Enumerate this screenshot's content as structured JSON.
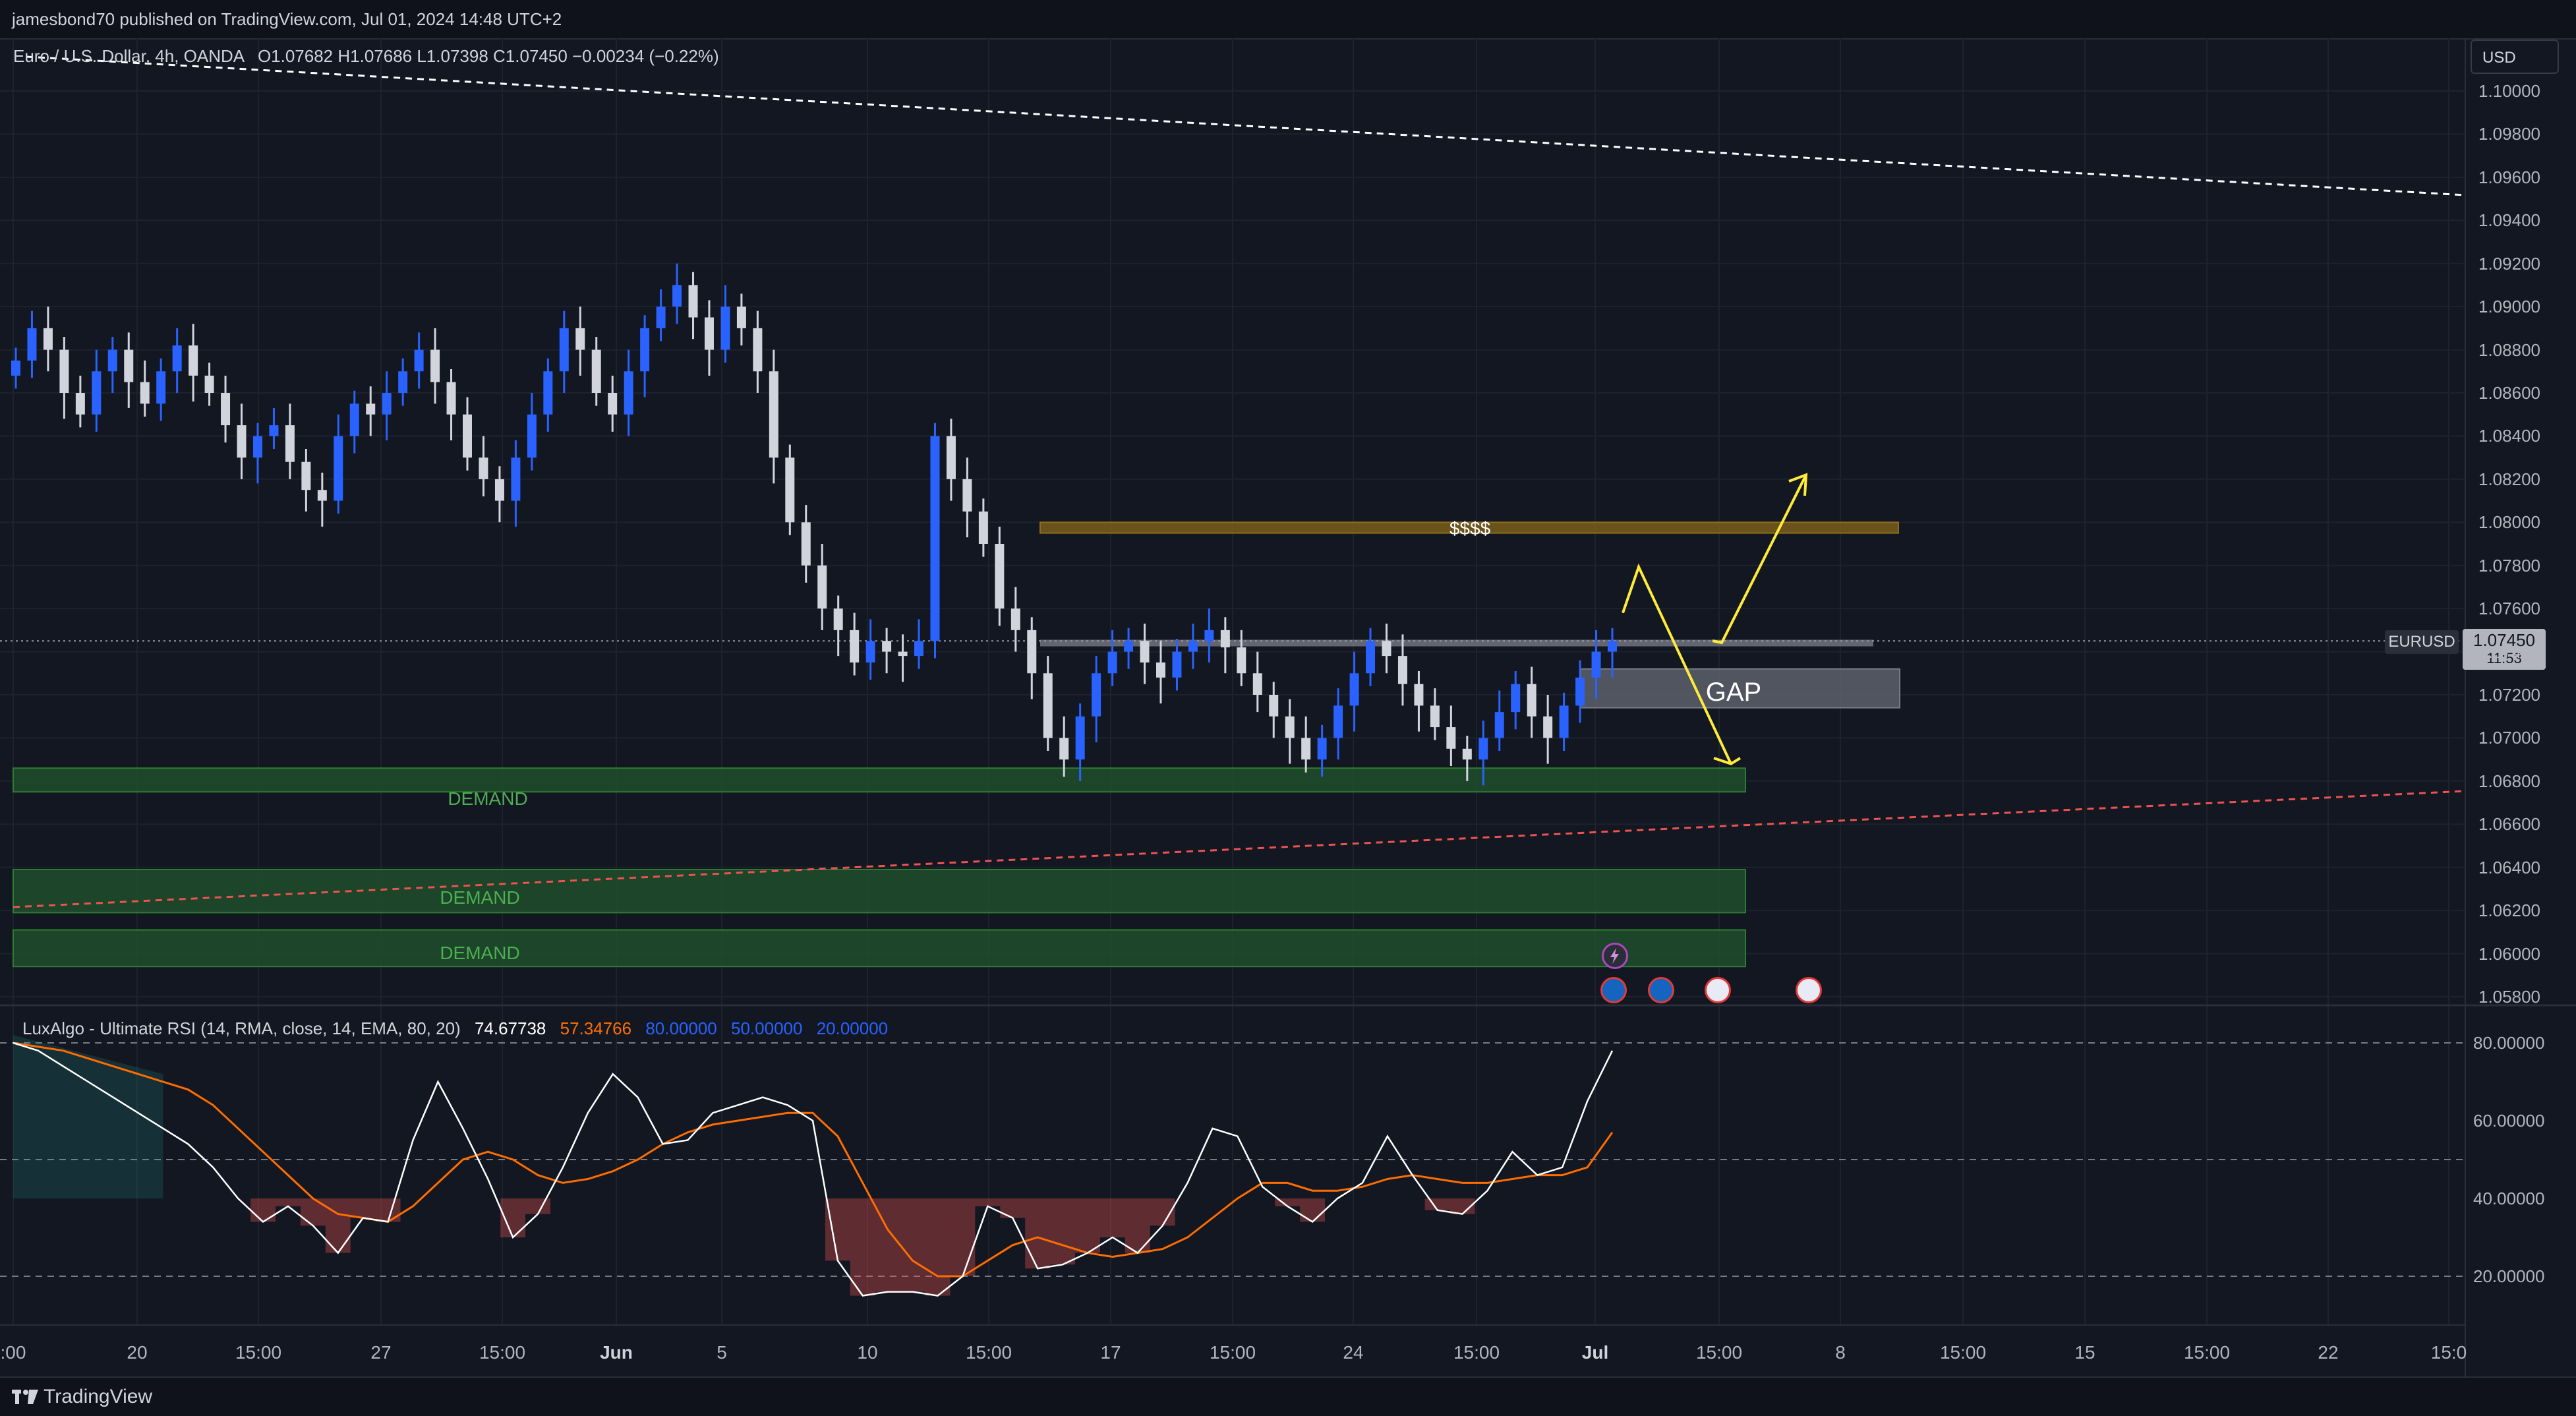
{
  "header": {
    "published": "jamesbond70 published on TradingView.com, Jul 01, 2024 14:48 UTC+2"
  },
  "chart_info": {
    "symbol_line": "Euro / U.S. Dollar, 4h, OANDA",
    "ohlc": "O1.07682  H1.07686  L1.07398  C1.07450  −0.00234 (−0.22%)"
  },
  "currency_button": "USD",
  "price_tag": {
    "symbol": "EURUSD",
    "price": "1.07450",
    "countdown": "11:53"
  },
  "annotations": {
    "money": "$$$$",
    "gap": "GAP",
    "demand1": "DEMAND",
    "demand2": "DEMAND",
    "demand3": "DEMAND"
  },
  "indicator": {
    "name": "LuxAlgo - Ultimate RSI (14, RMA, close, 14, EMA, 80, 20)",
    "rsi_value": "74.67738",
    "signal_value": "57.34766",
    "ob": "80.00000",
    "mid": "50.00000",
    "os": "20.00000",
    "colors": {
      "rsi": "#ffffff",
      "signal": "#ff6d00",
      "levels": "#2962ff",
      "overbought_fill": "#26a69a",
      "oversold_fill": "#ef5350"
    }
  },
  "footer": {
    "brand": "TradingView"
  },
  "colors": {
    "background": "#131722",
    "bull_candle": "#2962ff",
    "bear_candle": "#d1d4dc",
    "demand_zone": "#1e4d2b",
    "liquidity_zone": "#7a5d1a",
    "gap_zone": "#5d606b",
    "projection_arrow": "#ffeb3b"
  },
  "chart_data": [
    {
      "type": "candlestick",
      "title": "Euro / U.S. Dollar, 4h, OANDA",
      "ylim": [
        1.057,
        1.1015
      ],
      "y_ticks": [
        "1.10000",
        "1.09800",
        "1.09600",
        "1.09400",
        "1.09200",
        "1.09000",
        "1.08800",
        "1.08600",
        "1.08400",
        "1.08200",
        "1.08000",
        "1.07800",
        "1.07600",
        "1.07400",
        "1.07200",
        "1.07000",
        "1.06800",
        "1.06600",
        "1.06400",
        "1.06200",
        "1.06000",
        "1.05800"
      ],
      "x_ticks": [
        ":00",
        "20",
        "15:00",
        "27",
        "15:00",
        "Jun",
        "5",
        "10",
        "15:00",
        "17",
        "15:00",
        "24",
        "15:00",
        "Jul",
        "15:00",
        "8",
        "15:00",
        "15",
        "15:00",
        "22",
        "15:0"
      ],
      "series": [
        {
          "name": "EURUSD",
          "close": [
            1.0875,
            1.089,
            1.088,
            1.086,
            1.085,
            1.087,
            1.088,
            1.0865,
            1.0855,
            1.087,
            1.0882,
            1.0868,
            1.086,
            1.0845,
            1.083,
            1.084,
            1.0845,
            1.0828,
            1.0815,
            1.081,
            1.084,
            1.0855,
            1.085,
            1.086,
            1.087,
            1.088,
            1.0865,
            1.085,
            1.083,
            1.082,
            1.081,
            1.083,
            1.085,
            1.087,
            1.089,
            1.088,
            1.086,
            1.085,
            1.087,
            1.089,
            1.09,
            1.091,
            1.0895,
            1.088,
            1.09,
            1.089,
            1.087,
            1.083,
            1.08,
            1.078,
            1.076,
            1.075,
            1.0735,
            1.0745,
            1.074,
            1.0738,
            1.0745,
            1.084,
            1.082,
            1.0805,
            1.079,
            1.076,
            1.075,
            1.073,
            1.07,
            1.069,
            1.071,
            1.073,
            1.074,
            1.0745,
            1.0735,
            1.0728,
            1.074,
            1.0745,
            1.075,
            1.0742,
            1.073,
            1.072,
            1.071,
            1.07,
            1.069,
            1.07,
            1.0715,
            1.073,
            1.0745,
            1.0738,
            1.0725,
            1.0715,
            1.0705,
            1.0695,
            1.069,
            1.07,
            1.0712,
            1.0725,
            1.071,
            1.07,
            1.0715,
            1.0728,
            1.074,
            1.0745
          ]
        },
        {
          "name": "Liquidity $$$$",
          "level": 1.0798
        },
        {
          "name": "Projected high",
          "value": 1.0822
        },
        {
          "name": "Projected low",
          "value": 1.0688
        }
      ],
      "zones": [
        {
          "label": "DEMAND",
          "from": 1.0675,
          "to": 1.0686
        },
        {
          "label": "DEMAND",
          "from": 1.0619,
          "to": 1.0639
        },
        {
          "label": "DEMAND",
          "from": 1.0594,
          "to": 1.0611
        },
        {
          "label": "GAP",
          "from": 1.0714,
          "to": 1.0732
        },
        {
          "label": "$$$$",
          "from": 1.0795,
          "to": 1.08
        }
      ]
    },
    {
      "type": "line",
      "title": "LuxAlgo - Ultimate RSI (14, RMA, close, 14, EMA, 80, 20)",
      "ylim": [
        15,
        85
      ],
      "y_ticks": [
        "80.00000",
        "60.00000",
        "40.00000",
        "20.00000"
      ],
      "series": [
        {
          "name": "RSI",
          "values": [
            80,
            78,
            74,
            70,
            66,
            62,
            58,
            54,
            48,
            40,
            34,
            38,
            33,
            26,
            35,
            34,
            55,
            70,
            58,
            45,
            30,
            36,
            48,
            62,
            72,
            66,
            54,
            55,
            62,
            64,
            66,
            64,
            60,
            24,
            15,
            16,
            16,
            15,
            20,
            38,
            35,
            22,
            23,
            26,
            30,
            26,
            33,
            44,
            58,
            56,
            43,
            38,
            34,
            40,
            44,
            56,
            46,
            37,
            36,
            42,
            52,
            46,
            48,
            65,
            78
          ]
        },
        {
          "name": "Signal",
          "values": [
            80,
            79,
            78,
            76,
            74,
            72,
            70,
            68,
            64,
            58,
            52,
            46,
            40,
            36,
            35,
            34,
            38,
            44,
            50,
            52,
            50,
            46,
            44,
            45,
            47,
            50,
            54,
            57,
            59,
            60,
            61,
            62,
            62,
            56,
            44,
            32,
            24,
            20,
            20,
            24,
            28,
            30,
            28,
            26,
            25,
            26,
            27,
            30,
            35,
            40,
            44,
            44,
            42,
            42,
            43,
            45,
            46,
            45,
            44,
            44,
            45,
            46,
            46,
            48,
            57
          ]
        }
      ],
      "levels": [
        80,
        50,
        20
      ]
    }
  ]
}
